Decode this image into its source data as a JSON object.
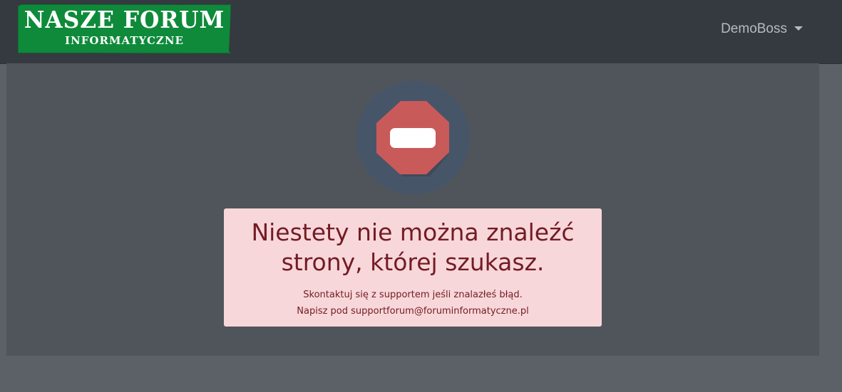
{
  "header": {
    "logo": {
      "title": "NASZE FORUM",
      "subtitle": "INFORMATYCZNE"
    },
    "user_menu": {
      "username": "DemoBoss",
      "icon": "caret-down-icon"
    }
  },
  "main": {
    "error_icon": "no-entry-sign-icon",
    "alert": {
      "heading": "Niestety nie można znaleźć strony, której szukasz.",
      "line1": "Skontaktuj się z supportem jeśli znalazłeś błąd.",
      "line2": "Napisz pod supportforum@foruminformatyczne.pl"
    }
  },
  "colors": {
    "navbar": "#343a40",
    "page_background": "#5c6168",
    "panel_background": "#4f555b",
    "logo_green": "#0e8a3a",
    "icon_circle": "#475569",
    "stop_sign": "#c95a5a",
    "alert_background": "#f8d7da",
    "alert_text": "#721c24"
  }
}
